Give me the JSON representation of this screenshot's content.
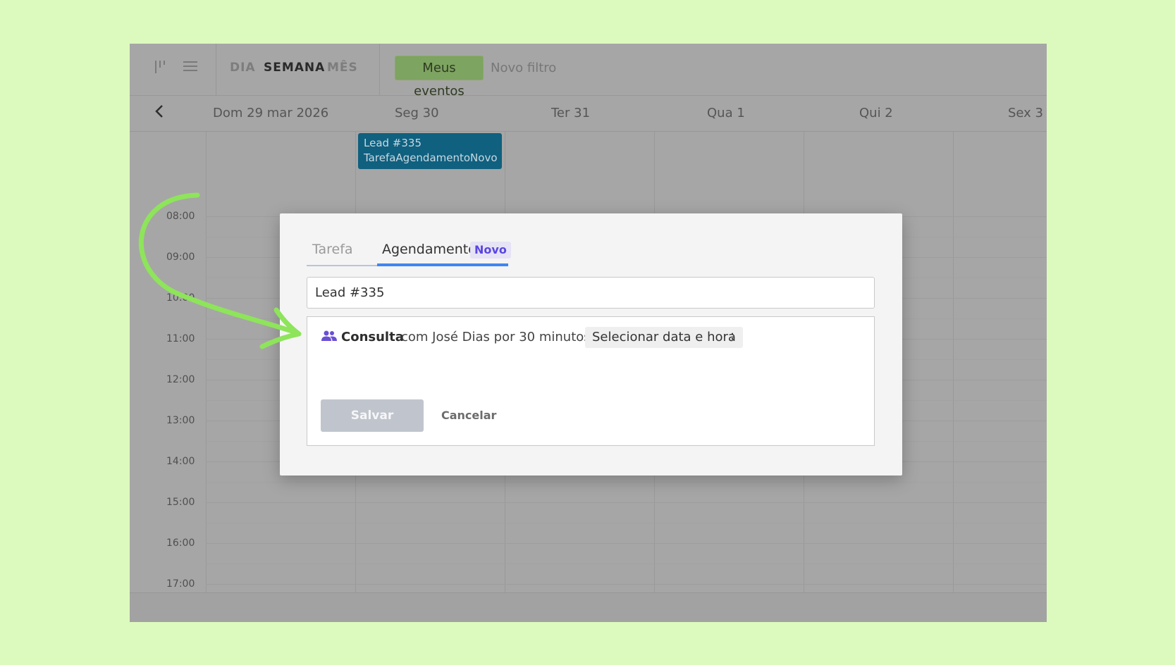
{
  "toolbar": {
    "icon_collapse": "collapse-icon",
    "icon_menu": "menu-icon",
    "views": [
      "DIA",
      "SEMANA",
      "MÊS"
    ],
    "active_view": "SEMANA",
    "filter_chip": "Meus eventos",
    "new_filter": "Novo filtro"
  },
  "days_header": {
    "back_icon": "chevron-left-icon",
    "days": [
      "Dom 29 mar 2026",
      "Seg 30",
      "Ter 31",
      "Qua 1",
      "Qui 2",
      "Sex 3"
    ]
  },
  "hours": [
    "08:00",
    "09:00",
    "10:00",
    "11:00",
    "12:00",
    "13:00",
    "14:00",
    "15:00",
    "16:00",
    "17:00"
  ],
  "event": {
    "line1": "Lead #335",
    "line2": "TarefaAgendamentoNovo"
  },
  "modal": {
    "tabs": [
      "Tarefa",
      "Agendamento"
    ],
    "active_tab": "Agendamento",
    "badge": "Novo",
    "title_value": "Lead #335",
    "service_icon": "people-icon",
    "service": "Consulta",
    "details": "com José Dias por 30 minutos",
    "select_datetime": "Selecionar data e hora",
    "colon": ":",
    "save": "Salvar",
    "cancel": "Cancelar"
  },
  "colors": {
    "page_bg": "#dcfabd",
    "accent_blue": "#3f86f1",
    "badge_purple": "#5a46e0",
    "event_blue": "#10607f",
    "arrow_green": "#8ee45a"
  }
}
